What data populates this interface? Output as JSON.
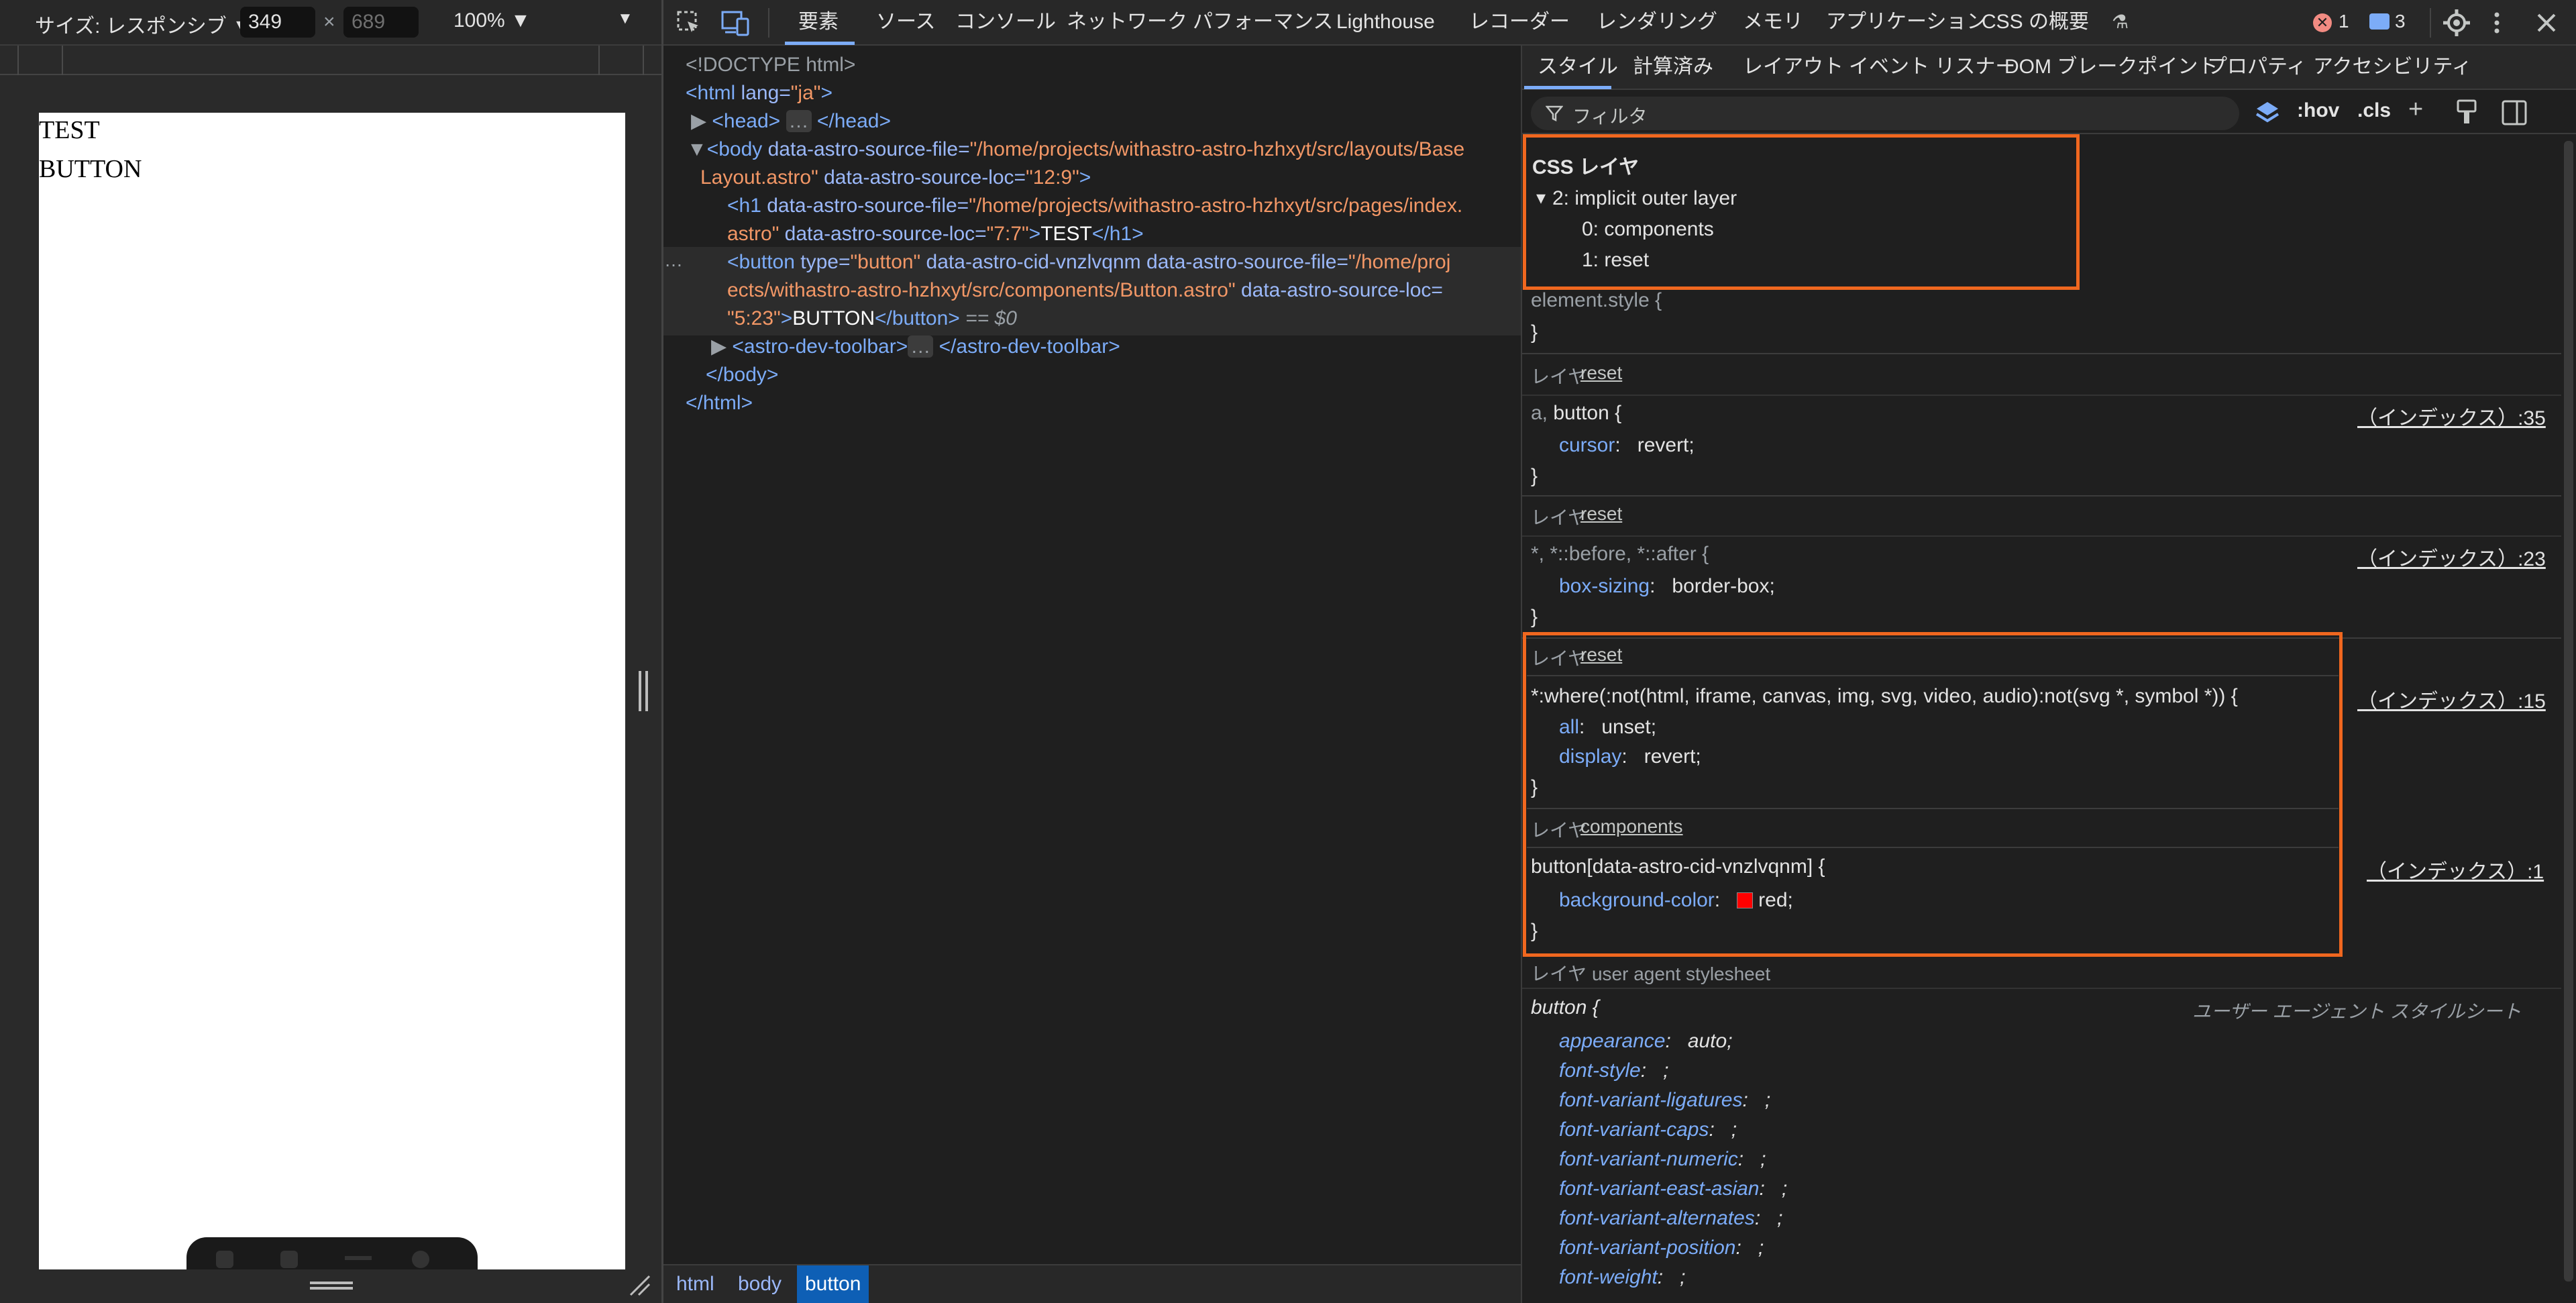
{
  "device_toolbar": {
    "size_label": "サイズ: レスポンシブ ▼",
    "width": "349",
    "times": "×",
    "height_placeholder": "689",
    "zoom": "100% ▼",
    "more": "▼"
  },
  "page_content": {
    "h1": "TEST",
    "button": "BUTTON"
  },
  "main_tabs": [
    {
      "label": "要素",
      "active": true
    },
    {
      "label": "ソース"
    },
    {
      "label": "コンソール"
    },
    {
      "label": "ネットワーク"
    },
    {
      "label": "パフォーマンス"
    },
    {
      "label": "Lighthouse"
    },
    {
      "label": "レコーダー"
    },
    {
      "label": "レンダリング"
    },
    {
      "label": "メモリ"
    },
    {
      "label": "アプリケーション"
    },
    {
      "label": "CSS の概要"
    }
  ],
  "status": {
    "errors": "1",
    "messages": "3"
  },
  "dom": {
    "doctype": "<!DOCTYPE html>",
    "html_open_tag": "<html",
    "html_lang_attr": " lang=",
    "html_lang_val": "\"ja\"",
    "gt": ">",
    "head_open": "<head>",
    "head_ellipsis": "…",
    "head_close": "</head>",
    "body_open": "<body",
    "body_attr1": " data-astro-source-file=",
    "body_val1a": "\"/home/projects/withastro-astro-hzhxyt/src/layouts/Base",
    "body_val1b": "Layout.astro\"",
    "body_attr2": " data-astro-source-loc=",
    "body_val2": "\"12:9\"",
    "h1_open": "<h1",
    "h1_attr1": " data-astro-source-file=",
    "h1_val1a": "\"/home/projects/withastro-astro-hzhxyt/src/pages/index.",
    "h1_val1b": "astro\"",
    "h1_attr2": " data-astro-source-loc=",
    "h1_val2": "\"7:7\"",
    "h1_text": "TEST",
    "h1_close": "</h1>",
    "btn_open": "<button",
    "btn_attr_type": " type=",
    "btn_val_type": "\"button\"",
    "btn_attr_cid": " data-astro-cid-vnzlvqnm",
    "btn_attr_file": " data-astro-source-file=",
    "btn_val_file_a": "\"/home/proj",
    "btn_val_file_b": "ects/withastro-astro-hzhxyt/src/components/Button.astro\"",
    "btn_attr_loc": " data-astro-source-loc=",
    "btn_val_loc": "\"5:23\"",
    "btn_text": "BUTTON",
    "btn_close": "</button>",
    "btn_eq": " == $0",
    "toolbar_open": "<astro-dev-toolbar>",
    "toolbar_ellipsis": "…",
    "toolbar_close": "</astro-dev-toolbar>",
    "body_close": "</body>",
    "html_close": "</html>",
    "row_dots": "…"
  },
  "breadcrumbs": [
    {
      "label": "html"
    },
    {
      "label": "body"
    },
    {
      "label": "button",
      "active": true
    }
  ],
  "styles_tabs": [
    {
      "label": "スタイル",
      "active": true
    },
    {
      "label": "計算済み"
    },
    {
      "label": "レイアウト"
    },
    {
      "label": "イベント リスナー"
    },
    {
      "label": "DOM ブレークポイント"
    },
    {
      "label": "プロパティ"
    },
    {
      "label": "アクセシビリティ"
    }
  ],
  "filter": {
    "placeholder": "フィルタ",
    "hov": ":hov",
    "cls": ".cls"
  },
  "css_layers": {
    "title": "CSS レイヤ",
    "root": "2: implicit outer layer",
    "children": [
      "0: components",
      "1: reset"
    ]
  },
  "rules": {
    "element_style_sel": "element.style {",
    "close": "}",
    "layer_label": "レイヤ",
    "r1_layer": "reset",
    "r1_sel_dim": "a, ",
    "r1_sel": "button {",
    "r1_prop": "cursor",
    "r1_val": "revert;",
    "r1_src": "（インデックス）:35",
    "r2_layer": "reset",
    "r2_sel": "*, *::before, *::after {",
    "r2_prop": "box-sizing",
    "r2_val": "border-box;",
    "r2_src": "（インデックス）:23",
    "r3_layer": "reset",
    "r3_sel": "*:where(:not(html, iframe, canvas, img, svg, video, audio):not(svg *, symbol *)) {",
    "r3_prop1": "all",
    "r3_val1": "unset;",
    "r3_prop2": "display",
    "r3_val2": "revert;",
    "r3_src": "（インデックス）:15",
    "r4_layer": "components",
    "r4_sel": "button[data-astro-cid-vnzlvqnm] {",
    "r4_prop": "background-color",
    "r4_val": "red;",
    "r4_swatch": "#ff0000",
    "r4_src": "（インデックス）:1",
    "ua_layer": "レイヤ user agent stylesheet",
    "ua_sel": "button {",
    "ua_src": "ユーザー エージェント スタイルシート",
    "ua_props": [
      {
        "p": "appearance",
        "v": "auto;"
      },
      {
        "p": "font-style",
        "v": ";"
      },
      {
        "p": "font-variant-ligatures",
        "v": ";"
      },
      {
        "p": "font-variant-caps",
        "v": ";"
      },
      {
        "p": "font-variant-numeric",
        "v": ";"
      },
      {
        "p": "font-variant-east-asian",
        "v": ";"
      },
      {
        "p": "font-variant-alternates",
        "v": ";"
      },
      {
        "p": "font-variant-position",
        "v": ";"
      },
      {
        "p": "font-weight",
        "v": ";"
      }
    ]
  },
  "colors": {
    "highlight": "#f0671f",
    "accent": "#7cacf8",
    "error": "#f28b82"
  }
}
